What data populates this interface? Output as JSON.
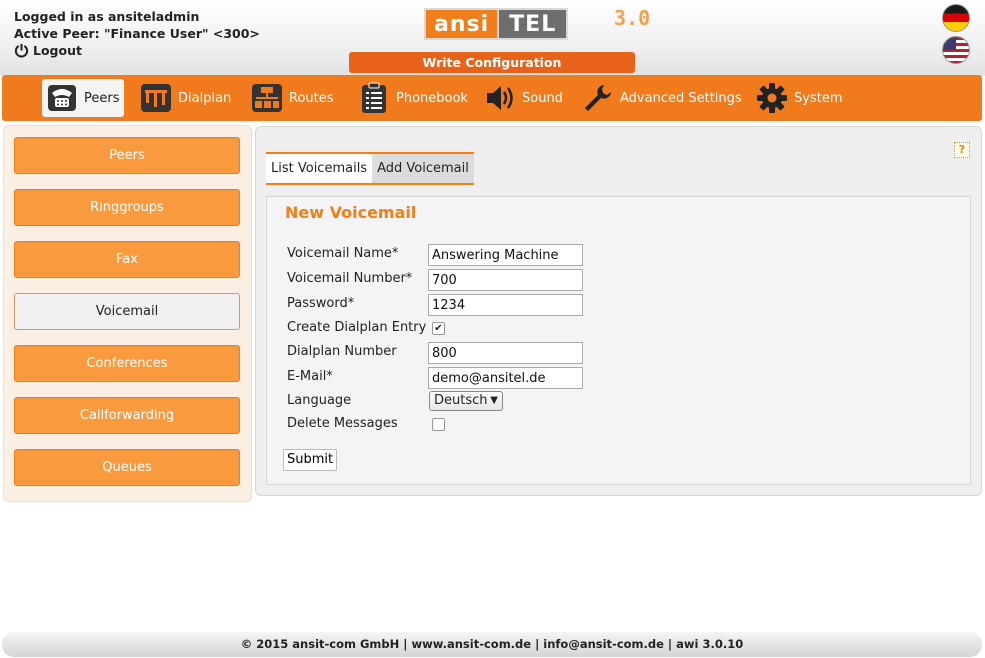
{
  "header": {
    "login_line": "Logged in as ansiteladmin",
    "peer_line": "Active Peer: \"Finance User\" <300>",
    "logout_label": "Logout",
    "logo_left": "ansi",
    "logo_right": "TEL",
    "logo_version": "3.0",
    "write_config_label": "Write Configuration",
    "flags": [
      "german-flag",
      "us-flag"
    ]
  },
  "nav": {
    "items": [
      {
        "label": "Peers",
        "icon": "phone-icon"
      },
      {
        "label": "Dialplan",
        "icon": "dialplan-icon"
      },
      {
        "label": "Routes",
        "icon": "routes-icon"
      },
      {
        "label": "Phonebook",
        "icon": "phonebook-icon"
      },
      {
        "label": "Sound",
        "icon": "speaker-icon"
      },
      {
        "label": "Advanced Settings",
        "icon": "wrench-icon"
      },
      {
        "label": "System",
        "icon": "gear-icon"
      }
    ],
    "active": "Peers"
  },
  "sidebar": {
    "items": [
      {
        "label": "Peers"
      },
      {
        "label": "Ringgroups"
      },
      {
        "label": "Fax"
      },
      {
        "label": "Voicemail"
      },
      {
        "label": "Conferences"
      },
      {
        "label": "Callforwarding"
      },
      {
        "label": "Queues"
      }
    ],
    "active": "Voicemail"
  },
  "main": {
    "help_label": "?",
    "tabs": [
      {
        "label": "List Voicemails"
      },
      {
        "label": "Add Voicemail"
      }
    ],
    "form": {
      "title": "New Voicemail",
      "fields": {
        "name_label": "Voicemail Name*",
        "name_value": "Answering Machine",
        "number_label": "Voicemail Number*",
        "number_value": "700",
        "password_label": "Password*",
        "password_value": "1234",
        "create_dialplan_label": "Create Dialplan Entry",
        "create_dialplan_checked": true,
        "dialplan_number_label": "Dialplan Number",
        "dialplan_number_value": "800",
        "email_label": "E-Mail*",
        "email_value": "demo@ansitel.de",
        "language_label": "Language",
        "language_value": "Deutsch",
        "delete_messages_label": "Delete Messages",
        "delete_messages_checked": false
      },
      "submit_label": "Submit"
    }
  },
  "footer": {
    "text": "© 2015 ansit-com GmbH | www.ansit-com.de | info@ansit-com.de | awi 3.0.10"
  },
  "colors": {
    "accent": "#f07a1c",
    "sidebar_button": "#fa9a3e",
    "write_config": "#e8621a"
  }
}
